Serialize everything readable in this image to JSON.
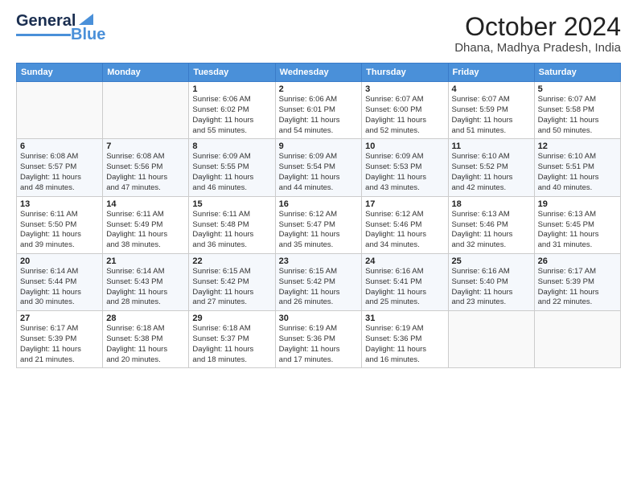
{
  "header": {
    "logo_line1": "General",
    "logo_line2": "Blue",
    "month": "October 2024",
    "location": "Dhana, Madhya Pradesh, India"
  },
  "weekdays": [
    "Sunday",
    "Monday",
    "Tuesday",
    "Wednesday",
    "Thursday",
    "Friday",
    "Saturday"
  ],
  "weeks": [
    [
      {
        "day": "",
        "info": ""
      },
      {
        "day": "",
        "info": ""
      },
      {
        "day": "1",
        "info": "Sunrise: 6:06 AM\nSunset: 6:02 PM\nDaylight: 11 hours\nand 55 minutes."
      },
      {
        "day": "2",
        "info": "Sunrise: 6:06 AM\nSunset: 6:01 PM\nDaylight: 11 hours\nand 54 minutes."
      },
      {
        "day": "3",
        "info": "Sunrise: 6:07 AM\nSunset: 6:00 PM\nDaylight: 11 hours\nand 52 minutes."
      },
      {
        "day": "4",
        "info": "Sunrise: 6:07 AM\nSunset: 5:59 PM\nDaylight: 11 hours\nand 51 minutes."
      },
      {
        "day": "5",
        "info": "Sunrise: 6:07 AM\nSunset: 5:58 PM\nDaylight: 11 hours\nand 50 minutes."
      }
    ],
    [
      {
        "day": "6",
        "info": "Sunrise: 6:08 AM\nSunset: 5:57 PM\nDaylight: 11 hours\nand 48 minutes."
      },
      {
        "day": "7",
        "info": "Sunrise: 6:08 AM\nSunset: 5:56 PM\nDaylight: 11 hours\nand 47 minutes."
      },
      {
        "day": "8",
        "info": "Sunrise: 6:09 AM\nSunset: 5:55 PM\nDaylight: 11 hours\nand 46 minutes."
      },
      {
        "day": "9",
        "info": "Sunrise: 6:09 AM\nSunset: 5:54 PM\nDaylight: 11 hours\nand 44 minutes."
      },
      {
        "day": "10",
        "info": "Sunrise: 6:09 AM\nSunset: 5:53 PM\nDaylight: 11 hours\nand 43 minutes."
      },
      {
        "day": "11",
        "info": "Sunrise: 6:10 AM\nSunset: 5:52 PM\nDaylight: 11 hours\nand 42 minutes."
      },
      {
        "day": "12",
        "info": "Sunrise: 6:10 AM\nSunset: 5:51 PM\nDaylight: 11 hours\nand 40 minutes."
      }
    ],
    [
      {
        "day": "13",
        "info": "Sunrise: 6:11 AM\nSunset: 5:50 PM\nDaylight: 11 hours\nand 39 minutes."
      },
      {
        "day": "14",
        "info": "Sunrise: 6:11 AM\nSunset: 5:49 PM\nDaylight: 11 hours\nand 38 minutes."
      },
      {
        "day": "15",
        "info": "Sunrise: 6:11 AM\nSunset: 5:48 PM\nDaylight: 11 hours\nand 36 minutes."
      },
      {
        "day": "16",
        "info": "Sunrise: 6:12 AM\nSunset: 5:47 PM\nDaylight: 11 hours\nand 35 minutes."
      },
      {
        "day": "17",
        "info": "Sunrise: 6:12 AM\nSunset: 5:46 PM\nDaylight: 11 hours\nand 34 minutes."
      },
      {
        "day": "18",
        "info": "Sunrise: 6:13 AM\nSunset: 5:46 PM\nDaylight: 11 hours\nand 32 minutes."
      },
      {
        "day": "19",
        "info": "Sunrise: 6:13 AM\nSunset: 5:45 PM\nDaylight: 11 hours\nand 31 minutes."
      }
    ],
    [
      {
        "day": "20",
        "info": "Sunrise: 6:14 AM\nSunset: 5:44 PM\nDaylight: 11 hours\nand 30 minutes."
      },
      {
        "day": "21",
        "info": "Sunrise: 6:14 AM\nSunset: 5:43 PM\nDaylight: 11 hours\nand 28 minutes."
      },
      {
        "day": "22",
        "info": "Sunrise: 6:15 AM\nSunset: 5:42 PM\nDaylight: 11 hours\nand 27 minutes."
      },
      {
        "day": "23",
        "info": "Sunrise: 6:15 AM\nSunset: 5:42 PM\nDaylight: 11 hours\nand 26 minutes."
      },
      {
        "day": "24",
        "info": "Sunrise: 6:16 AM\nSunset: 5:41 PM\nDaylight: 11 hours\nand 25 minutes."
      },
      {
        "day": "25",
        "info": "Sunrise: 6:16 AM\nSunset: 5:40 PM\nDaylight: 11 hours\nand 23 minutes."
      },
      {
        "day": "26",
        "info": "Sunrise: 6:17 AM\nSunset: 5:39 PM\nDaylight: 11 hours\nand 22 minutes."
      }
    ],
    [
      {
        "day": "27",
        "info": "Sunrise: 6:17 AM\nSunset: 5:39 PM\nDaylight: 11 hours\nand 21 minutes."
      },
      {
        "day": "28",
        "info": "Sunrise: 6:18 AM\nSunset: 5:38 PM\nDaylight: 11 hours\nand 20 minutes."
      },
      {
        "day": "29",
        "info": "Sunrise: 6:18 AM\nSunset: 5:37 PM\nDaylight: 11 hours\nand 18 minutes."
      },
      {
        "day": "30",
        "info": "Sunrise: 6:19 AM\nSunset: 5:36 PM\nDaylight: 11 hours\nand 17 minutes."
      },
      {
        "day": "31",
        "info": "Sunrise: 6:19 AM\nSunset: 5:36 PM\nDaylight: 11 hours\nand 16 minutes."
      },
      {
        "day": "",
        "info": ""
      },
      {
        "day": "",
        "info": ""
      }
    ]
  ]
}
